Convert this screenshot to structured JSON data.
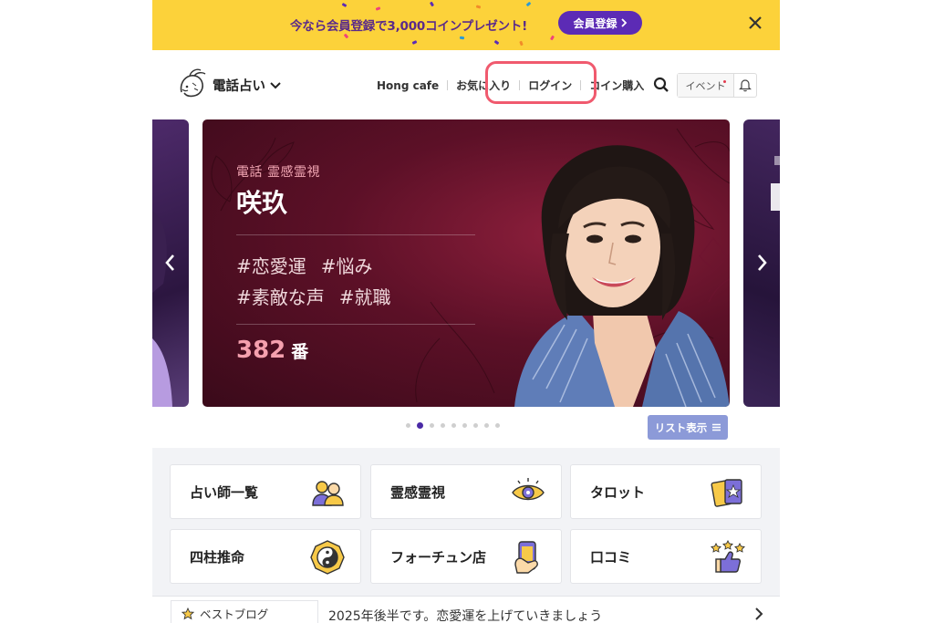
{
  "promo": {
    "text": "今なら会員登録で3,000コインプレゼント!",
    "button_label": "会員登録",
    "background_color": "#fcd23a"
  },
  "header": {
    "brand": "電話占い",
    "nav": [
      "Hong cafe",
      "お気に入り",
      "ログイン",
      "コイン購入"
    ],
    "event_label": "イベント",
    "icons": [
      "search-icon",
      "bell-icon",
      "logo-mascot",
      "chevron-down-icon"
    ]
  },
  "carousel": {
    "category": "電話  霊感霊視",
    "name": "咲玖",
    "tags": [
      "#恋愛運",
      "#悩み",
      "#素敵な声",
      "#就職"
    ],
    "number": "382",
    "number_unit": "番",
    "dots_total": 9,
    "active_dot": 2,
    "list_button_label": "リスト表示"
  },
  "menu": {
    "items": [
      {
        "label": "占い師一覧",
        "icon": "fortune-tellers-icon"
      },
      {
        "label": "霊感霊視",
        "icon": "eye-icon"
      },
      {
        "label": "タロット",
        "icon": "tarot-icon"
      },
      {
        "label": "四柱推命",
        "icon": "yin-yang-icon"
      },
      {
        "label": "フォーチュン店",
        "icon": "phone-hand-icon"
      },
      {
        "label": "口コミ",
        "icon": "thumbs-up-icon"
      }
    ]
  },
  "blog": {
    "tab_label": "ベストブログ",
    "headline": "2025年後半です。恋愛運を上げていきましょう"
  },
  "colors": {
    "accent_purple": "#5c2bb5",
    "highlight_red": "#f05a6e",
    "list_button": "#8c9ad8"
  }
}
